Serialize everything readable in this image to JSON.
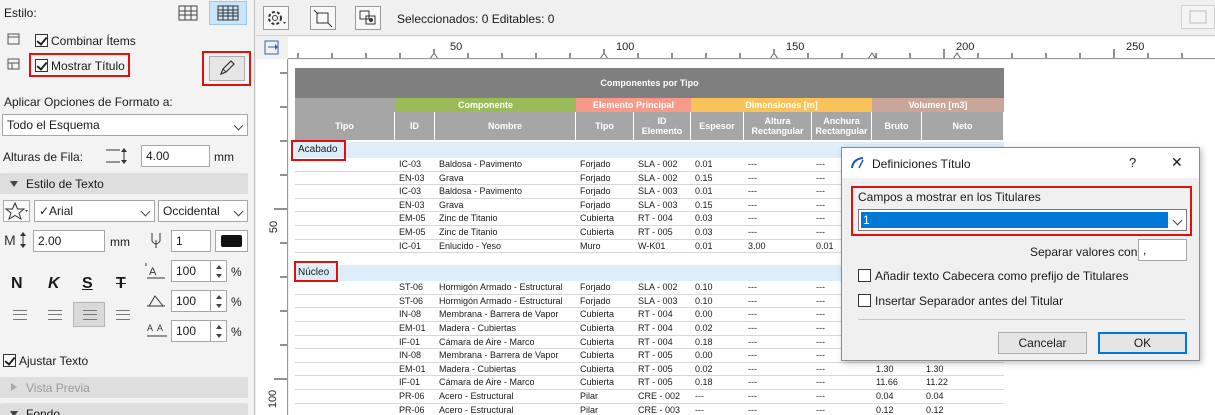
{
  "left_panel": {
    "style_label": "Estilo:",
    "combine_items_label": "Combinar Ítems",
    "show_title_label": "Mostrar Título",
    "apply_format_label": "Aplicar Opciones de Formato a:",
    "apply_format_value": "Todo el Esquema",
    "row_height_label": "Alturas de Fila:",
    "row_height_value": "4.00",
    "row_height_unit": "mm",
    "text_style_section": "Estilo de Texto",
    "font_value": "✓Arial",
    "script_value": "Occidental",
    "font_size_value": "2.00",
    "font_size_unit": "mm",
    "pen_value": "1",
    "bold_glyph": "N",
    "italic_glyph": "K",
    "underline_glyph": "S",
    "strike_glyph": "T",
    "scale1_value": "100",
    "scale2_value": "100",
    "scale3_value": "100",
    "percent": "%",
    "adjust_text_label": "Ajustar Texto",
    "preview_section": "Vista Previa",
    "background_section": "Fondo"
  },
  "toolbar": {
    "status_text": "Seleccionados: 0  Editables: 0"
  },
  "ruler": {
    "h_labels": [
      "50",
      "100",
      "150",
      "200",
      "250"
    ],
    "v_labels": [
      "50",
      "100"
    ]
  },
  "schedule": {
    "title": "Componentes por Tipo",
    "groups": [
      {
        "label": "",
        "color": "#a6a6a6"
      },
      {
        "label": "Componente",
        "color": "#9bbb59"
      },
      {
        "label": "Elemento Principal",
        "color": "#f79a8a"
      },
      {
        "label": "Dimensiones  [m]",
        "color": "#fac35a"
      },
      {
        "label": "Volumen [m3]",
        "color": "#c9a697"
      }
    ],
    "headers": [
      "Tipo",
      "ID",
      "Nombre",
      "Tipo",
      "ID\nElemento",
      "Espesor",
      "Altura\nRectangular",
      "Anchura\nRectangular",
      "Bruto",
      "Neto"
    ],
    "categories": [
      {
        "name": "Acabado",
        "rows": [
          [
            "",
            "IC-03",
            "Baldosa - Pavimento",
            "Forjado",
            "SLA - 002",
            "0.01",
            "---",
            "---",
            "",
            ""
          ],
          [
            "",
            "EN-03",
            "Grava",
            "Forjado",
            "SLA - 002",
            "0.15",
            "---",
            "---",
            "",
            ""
          ],
          [
            "",
            "IC-03",
            "Baldosa - Pavimento",
            "Forjado",
            "SLA - 003",
            "0.01",
            "---",
            "---",
            "",
            ""
          ],
          [
            "",
            "EN-03",
            "Grava",
            "Forjado",
            "SLA - 003",
            "0.15",
            "---",
            "---",
            "",
            ""
          ],
          [
            "",
            "EM-05",
            "Zinc de Titanio",
            "Cubierta",
            "RT - 004",
            "0.03",
            "---",
            "---",
            "",
            ""
          ],
          [
            "",
            "EM-05",
            "Zinc de Titanio",
            "Cubierta",
            "RT - 005",
            "0.03",
            "---",
            "---",
            "",
            ""
          ],
          [
            "",
            "IC-01",
            "Enlucido - Yeso",
            "Muro",
            "W-K01",
            "0.01",
            "3.00",
            "0.01",
            "",
            ""
          ]
        ]
      },
      {
        "name": "Núcleo",
        "rows": [
          [
            "",
            "ST-06",
            "Hormigón Armado - Estructural",
            "Forjado",
            "SLA - 002",
            "0.10",
            "---",
            "---",
            "",
            ""
          ],
          [
            "",
            "ST-06",
            "Hormigón Armado - Estructural",
            "Forjado",
            "SLA - 003",
            "0.10",
            "---",
            "---",
            "",
            ""
          ],
          [
            "",
            "IN-08",
            "Membrana - Barrera de Vapor",
            "Cubierta",
            "RT - 004",
            "0.00",
            "---",
            "---",
            "",
            ""
          ],
          [
            "",
            "EM-01",
            "Madera - Cubiertas",
            "Cubierta",
            "RT - 004",
            "0.02",
            "---",
            "---",
            "",
            ""
          ],
          [
            "",
            "IF-01",
            "Cámara de Aire - Marco",
            "Cubierta",
            "RT - 004",
            "0.18",
            "---",
            "---",
            "",
            ""
          ],
          [
            "",
            "IN-08",
            "Membrana - Barrera de Vapor",
            "Cubierta",
            "RT - 005",
            "0.00",
            "---",
            "---",
            "",
            ""
          ],
          [
            "",
            "EM-01",
            "Madera - Cubiertas",
            "Cubierta",
            "RT - 005",
            "0.02",
            "---",
            "---",
            "1.30",
            "1.30"
          ],
          [
            "",
            "IF-01",
            "Cámara de Aire - Marco",
            "Cubierta",
            "RT - 005",
            "0.18",
            "---",
            "---",
            "11.66",
            "11.22"
          ],
          [
            "",
            "PR-06",
            "Acero - Estructural",
            "Pilar",
            "CRE - 002",
            "---",
            "---",
            "---",
            "0.04",
            "0.04"
          ],
          [
            "",
            "PR-06",
            "Acero - Estructural",
            "Pilar",
            "CRE - 003",
            "---",
            "---",
            "---",
            "0.12",
            "0.12"
          ]
        ]
      }
    ]
  },
  "dialog": {
    "title": "Definiciones Título",
    "help": "?",
    "close": "✕",
    "fields_label": "Campos a mostrar en los Titulares",
    "fields_value": "1",
    "separator_label": "Separar valores con:",
    "separator_value": ",",
    "opt1_label": "Añadir texto Cabecera como prefijo de Titulares",
    "opt2_label": "Insertar Separador antes del Titular",
    "cancel": "Cancelar",
    "ok": "OK"
  },
  "colors": {
    "highlight_red": "#e01010",
    "selection_blue": "#0078d7",
    "category_fill": "#ddeefa"
  }
}
